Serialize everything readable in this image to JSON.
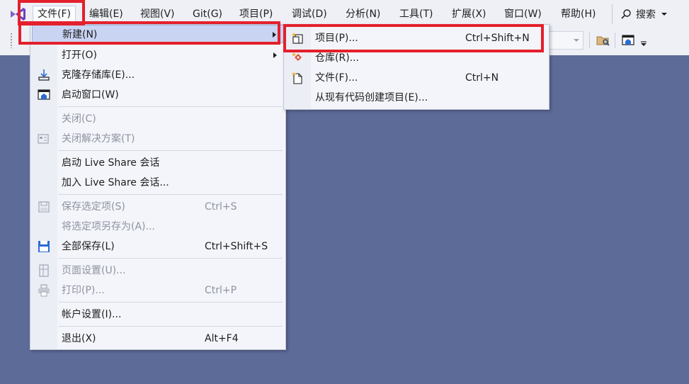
{
  "menubar": {
    "items": [
      {
        "label": "文件(F)",
        "open": true
      },
      {
        "label": "编辑(E)"
      },
      {
        "label": "视图(V)"
      },
      {
        "label": "Git(G)"
      },
      {
        "label": "项目(P)"
      },
      {
        "label": "调试(D)"
      },
      {
        "label": "分析(N)"
      },
      {
        "label": "工具(T)"
      },
      {
        "label": "扩展(X)"
      },
      {
        "label": "窗口(W)"
      },
      {
        "label": "帮助(H)"
      }
    ],
    "search_label": "搜索"
  },
  "file_menu": {
    "new": "新建(N)",
    "open": "打开(O)",
    "clone": "克隆存储库(E)...",
    "start_window": "启动窗口(W)",
    "close": "关闭(C)",
    "close_solution": "关闭解决方案(T)",
    "start_live_share": "启动 Live Share 会话",
    "join_live_share": "加入 Live Share 会话...",
    "save_selected": "保存选定项(S)",
    "save_selected_shortcut": "Ctrl+S",
    "save_as": "将选定项另存为(A)...",
    "save_all": "全部保存(L)",
    "save_all_shortcut": "Ctrl+Shift+S",
    "page_setup": "页面设置(U)...",
    "print": "打印(P)...",
    "print_shortcut": "Ctrl+P",
    "account_settings": "帐户设置(I)...",
    "exit": "退出(X)",
    "exit_shortcut": "Alt+F4"
  },
  "new_submenu": {
    "project": "项目(P)...",
    "project_shortcut": "Ctrl+Shift+N",
    "repository": "仓库(R)...",
    "file": "文件(F)...",
    "file_shortcut": "Ctrl+N",
    "project_from_code": "从现有代码创建项目(E)..."
  },
  "colors": {
    "accent_highlight": "#c9d4f3",
    "workspace_bg": "#5d6b99",
    "annotation_red": "#e3202c",
    "vs_purple": "#8661c5"
  }
}
